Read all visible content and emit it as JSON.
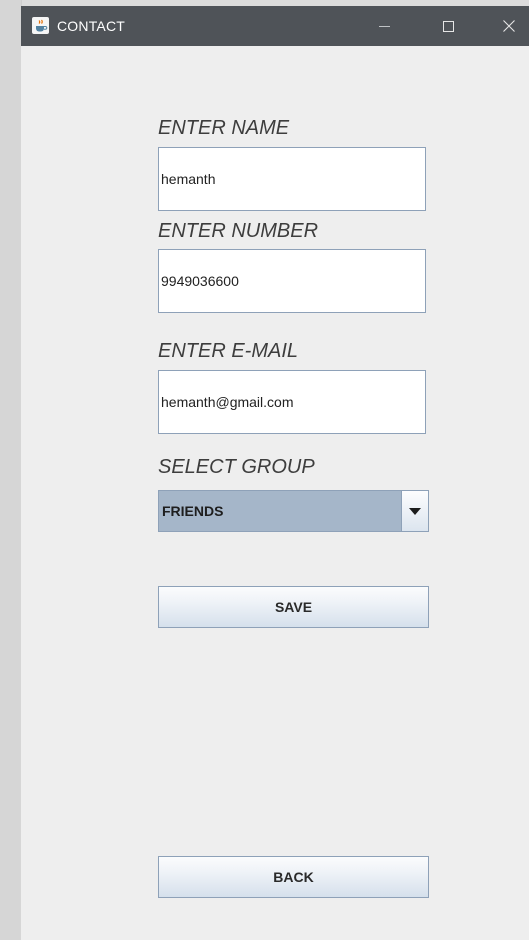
{
  "window": {
    "title": "CONTACT",
    "icon": "java-cup-icon"
  },
  "form": {
    "name_label": "ENTER NAME",
    "name_value": "hemanth",
    "number_label": "ENTER NUMBER",
    "number_value": "9949036600",
    "email_label": "ENTER E-MAIL",
    "email_value": "hemanth@gmail.com",
    "group_label": "SELECT GROUP",
    "group_selected": "FRIENDS"
  },
  "buttons": {
    "save_label": "SAVE",
    "back_label": "BACK"
  },
  "colors": {
    "titlebar": "#4f5358",
    "window_bg": "#eeeeee",
    "field_border": "#8ea1b8",
    "combo_bg": "#a5b6c9"
  }
}
